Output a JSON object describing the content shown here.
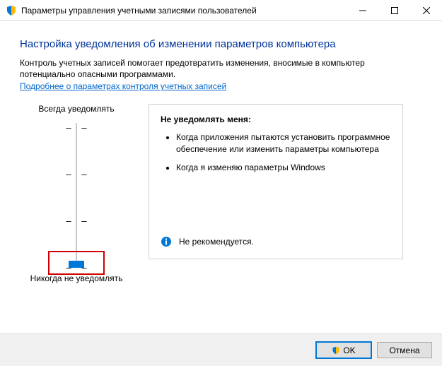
{
  "titlebar": {
    "title": "Параметры управления учетными записями пользователей"
  },
  "heading": "Настройка уведомления об изменении параметров компьютера",
  "description": "Контроль учетных записей помогает предотвратить изменения, вносимые в компьютер потенциально опасными программами.",
  "link": "Подробнее о параметрах контроля учетных записей",
  "slider": {
    "top_label": "Всегда уведомлять",
    "bottom_label": "Никогда не уведомлять",
    "levels": 4,
    "current_level": 0
  },
  "panel": {
    "title": "Не уведомлять меня:",
    "bullets": [
      "Когда приложения пытаются установить программное обеспечение или изменить параметры компьютера",
      "Когда я изменяю параметры Windows"
    ],
    "recommendation": "Не рекомендуется."
  },
  "buttons": {
    "ok": "OK",
    "cancel": "Отмена"
  }
}
